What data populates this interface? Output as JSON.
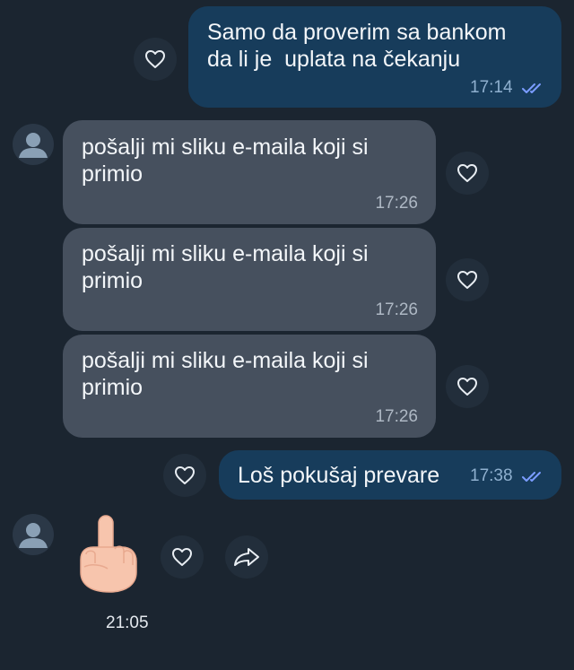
{
  "messages": [
    {
      "direction": "outgoing",
      "text": "Samo da proverim sa bankom\nda li je  uplata na čekanju",
      "time": "17:14",
      "status": "read"
    },
    {
      "direction": "incoming",
      "text": "pošalji mi sliku e-maila koji si\nprimio",
      "time": "17:26"
    },
    {
      "direction": "incoming",
      "text": "pošalji mi sliku e-maila koji si\nprimio",
      "time": "17:26"
    },
    {
      "direction": "incoming",
      "text": "pošalji mi sliku e-maila koji si\nprimio",
      "time": "17:26"
    },
    {
      "direction": "outgoing",
      "text": "Loš pokušaj prevare",
      "time": "17:38",
      "status": "read"
    },
    {
      "direction": "incoming",
      "type": "sticker",
      "sticker": "middle-finger-hand",
      "time": "21:05"
    }
  ],
  "icons": {
    "reaction": "heart-outline-icon",
    "forward": "forward-arrow-icon",
    "avatar": "default-user-avatar-icon",
    "read_receipt": "double-check-icon"
  },
  "colors": {
    "background": "#1b2530",
    "outgoing_bubble": "#173c5b",
    "incoming_bubble": "#46505e",
    "read_check": "#7b9cff",
    "skin": "#f7c5ad"
  }
}
